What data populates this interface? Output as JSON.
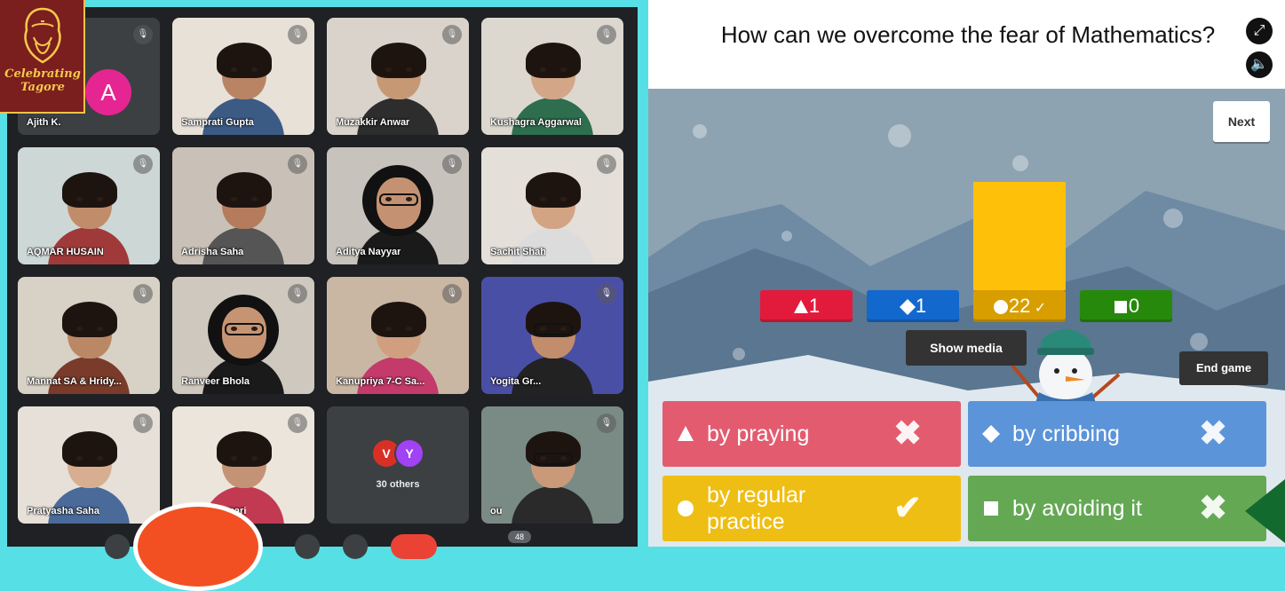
{
  "meeting": {
    "participants": [
      {
        "name": "Ajith K.",
        "avatar_letter": "A",
        "avatar_color": "#e52592"
      },
      {
        "name": "Samprati Gupta"
      },
      {
        "name": "Muzakkir Anwar"
      },
      {
        "name": "Kushagra Aggarwal"
      },
      {
        "name": "AQMAR HUSAIN"
      },
      {
        "name": "Adrisha Saha"
      },
      {
        "name": "Aditya Nayyar"
      },
      {
        "name": "Sachit Shah"
      },
      {
        "name": "Mannat SA & Hridy..."
      },
      {
        "name": "Ranveer Bhola"
      },
      {
        "name": "Kanupriya 7-C Sa..."
      },
      {
        "name": "Yogita Gr..."
      },
      {
        "name": "Pratyasha Saha"
      },
      {
        "name": "Navya Kumari"
      },
      {
        "name": "30 others",
        "avatars": [
          "V",
          "Y"
        ]
      },
      {
        "name": "ou"
      }
    ],
    "participant_count": "48",
    "mic_icon": "mic-off-icon"
  },
  "logo": {
    "line1": "Celebrating",
    "line2": "Tagore"
  },
  "kahoot": {
    "question": "How can we overcome the fear of Mathematics?",
    "next_label": "Next",
    "show_media_label": "Show media",
    "end_game_label": "End game",
    "results": [
      {
        "shape": "triangle",
        "count": "1",
        "color": "#e21b3c"
      },
      {
        "shape": "diamond",
        "count": "1",
        "color": "#1368ce"
      },
      {
        "shape": "circle",
        "count": "22",
        "correct": true,
        "color": "#d89e00"
      },
      {
        "shape": "square",
        "count": "0",
        "color": "#26890c"
      }
    ],
    "answers": [
      {
        "shape": "triangle",
        "text": "by praying",
        "correct": false,
        "color": "#e35b6f"
      },
      {
        "shape": "diamond",
        "text": "by cribbing",
        "correct": false,
        "color": "#5b94d9"
      },
      {
        "shape": "circle",
        "text": "by regular practice",
        "correct": true,
        "color": "#efbe14"
      },
      {
        "shape": "square",
        "text": "by avoiding it",
        "correct": false,
        "color": "#64a854"
      }
    ]
  }
}
